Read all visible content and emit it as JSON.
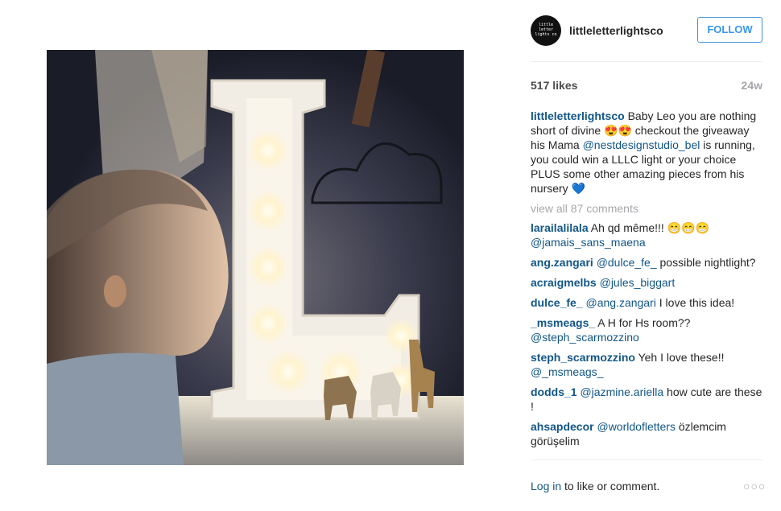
{
  "post": {
    "username": "littleletterlightsco",
    "avatar_text": "little letter lights co",
    "follow_label": "FOLLOW",
    "likes": "517 likes",
    "age": "24w",
    "caption": {
      "user": "littleletterlightsco",
      "text1": " Baby Leo you are nothing short of divine 😍😍 checkout the giveaway his Mama ",
      "mention": "@nestdesignstudio_bel",
      "text2": " is running, you could win a LLLC light or your choice PLUS some other amazing pieces from his nursery 💙"
    },
    "view_all": "view all 87 comments",
    "comments": [
      {
        "user": "larailalilala",
        "pre": " Ah qd même!!! 😁😁😁 ",
        "mention": "@jamais_sans_maena",
        "post": ""
      },
      {
        "user": "ang.zangari",
        "pre": " ",
        "mention": "@dulce_fe_",
        "post": " possible nightlight?"
      },
      {
        "user": "acraigmelbs",
        "pre": " ",
        "mention": "@jules_biggart",
        "post": ""
      },
      {
        "user": "dulce_fe_",
        "pre": " ",
        "mention": "@ang.zangari",
        "post": " I love this idea!"
      },
      {
        "user": "_msmeags_",
        "pre": " A H for Hs room?? ",
        "mention": "@steph_scarmozzino",
        "post": ""
      },
      {
        "user": "steph_scarmozzino",
        "pre": " Yeh I love these!! ",
        "mention": "@_msmeags_",
        "post": ""
      },
      {
        "user": "dodds_1",
        "pre": " ",
        "mention": "@jazmine.ariella",
        "post": " how cute are these !"
      },
      {
        "user": "ahsapdecor",
        "pre": " ",
        "mention": "@worldofletters",
        "post": " özlemcim görüşelim"
      }
    ],
    "footer": {
      "login_link": "Log in",
      "login_text": " to like or comment.",
      "more_icon": "more-options-icon"
    }
  },
  "photo": {
    "letter": "L",
    "accent_glow": "#fff6d8",
    "background": "#1b1d2a"
  }
}
